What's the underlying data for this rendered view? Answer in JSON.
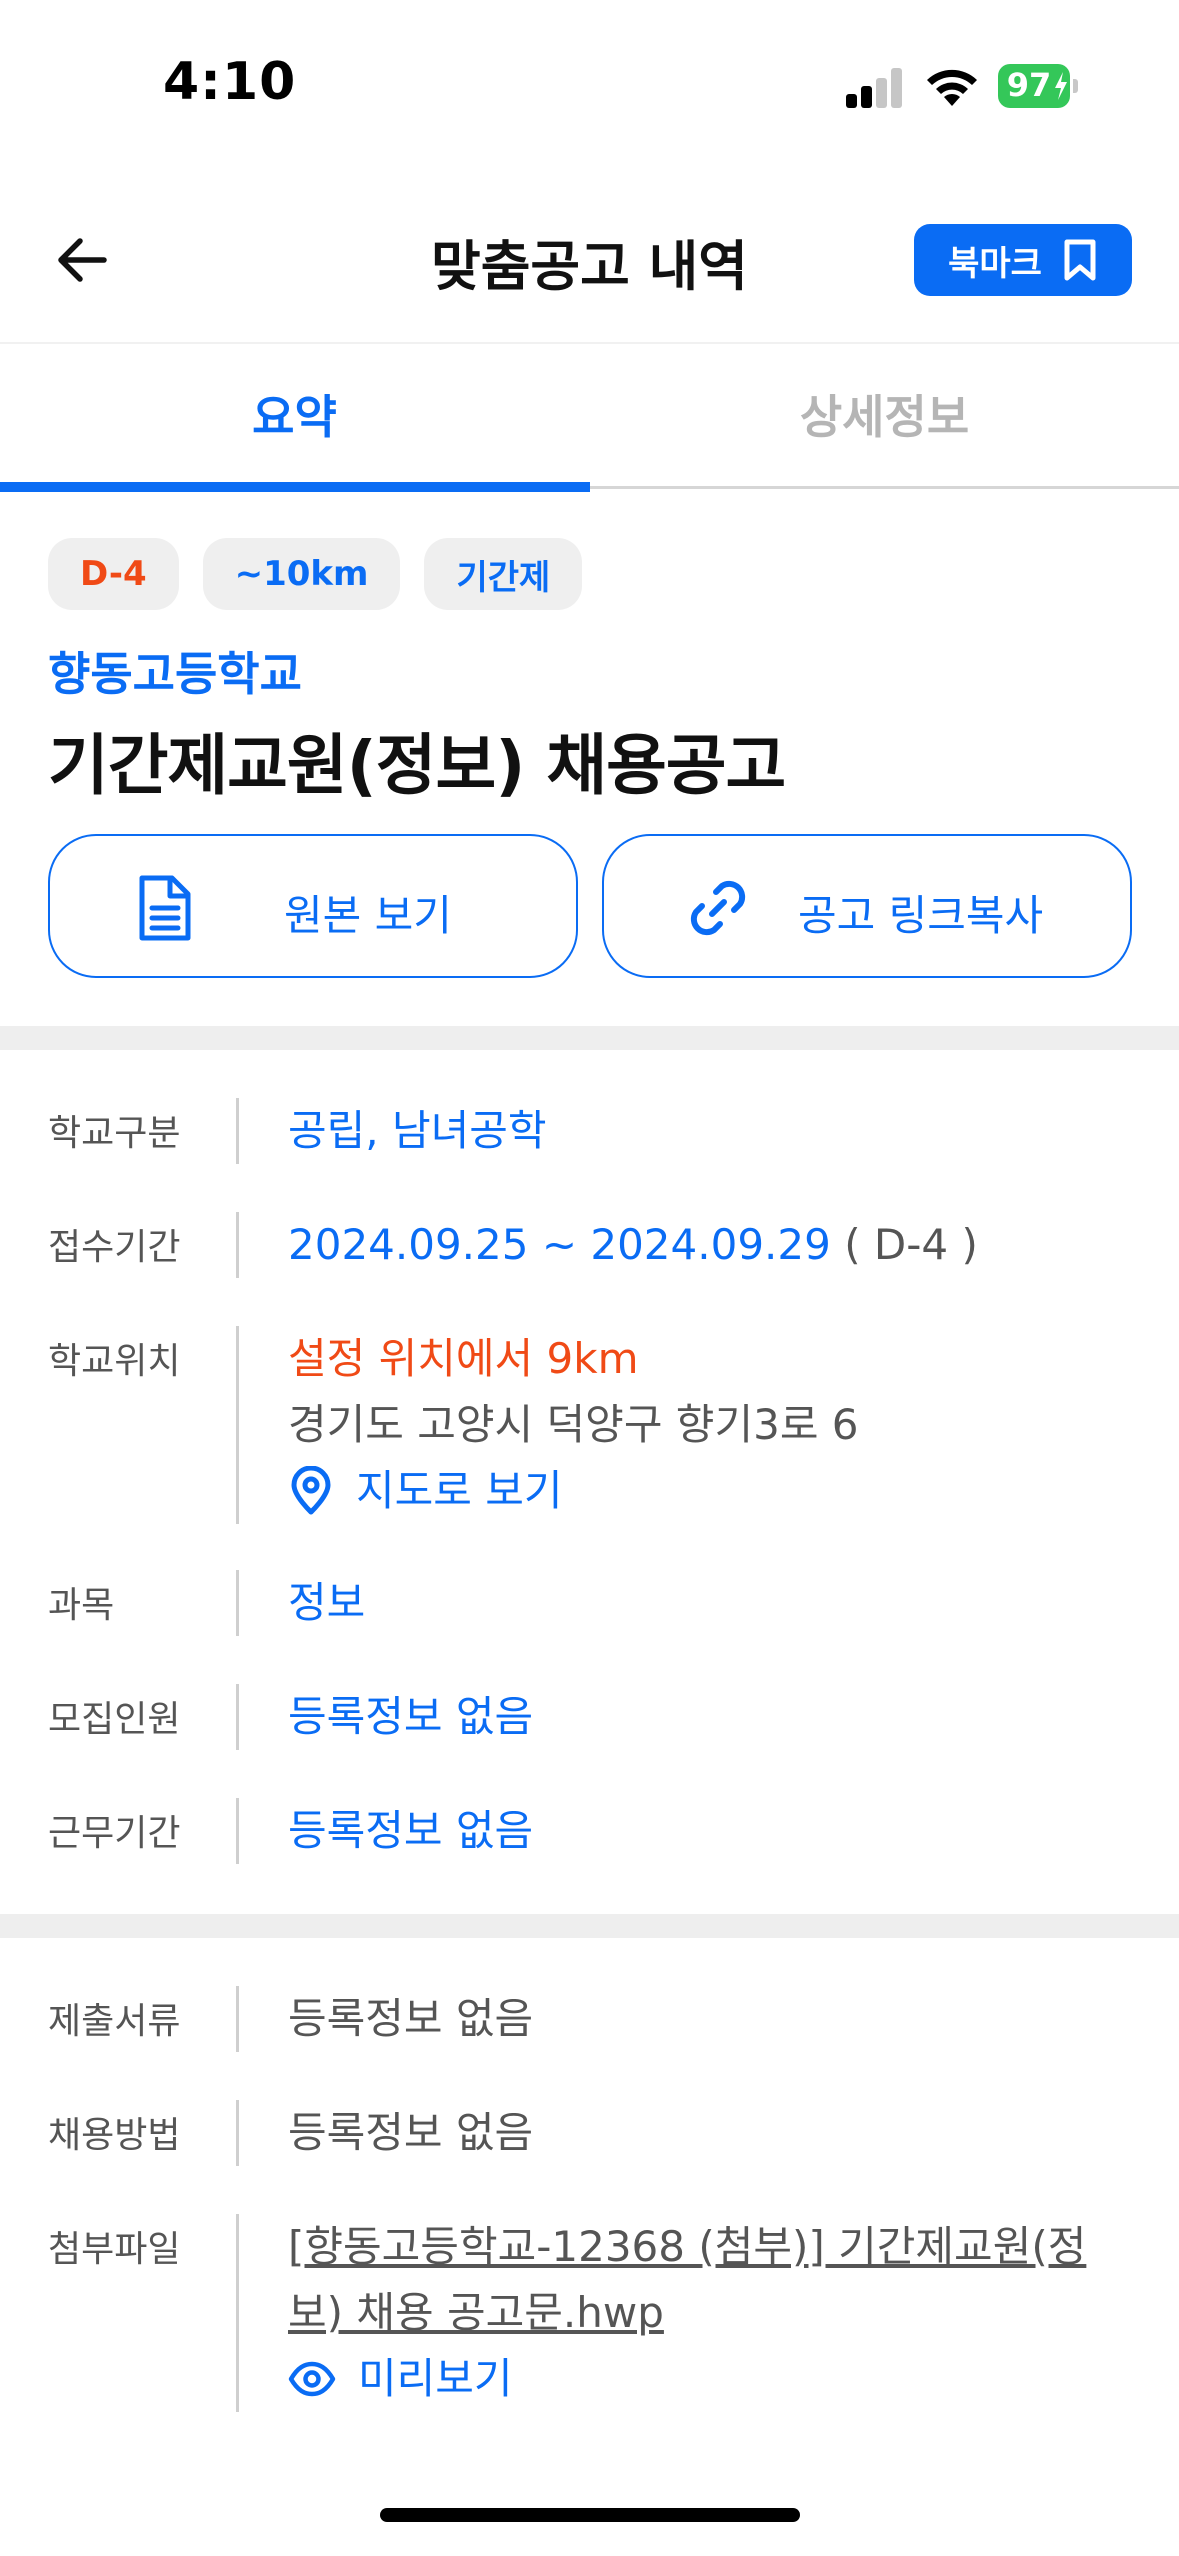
{
  "status_bar": {
    "time": "4:10",
    "battery_percent": "97",
    "battery_color": "#34c759",
    "icons": [
      "cellular-signal-icon",
      "wifi-icon",
      "battery-charging-icon"
    ]
  },
  "header": {
    "title": "맞춤공고 내역",
    "back_icon": "arrow-left-icon",
    "bookmark_label": "북마크",
    "bookmark_icon": "bookmark-icon"
  },
  "tabs": [
    {
      "label": "요약",
      "active": true
    },
    {
      "label": "상세정보",
      "active": false
    }
  ],
  "chips": {
    "dday": "D-4",
    "distance": "~10km",
    "type": "기간제"
  },
  "posting": {
    "school_name": "향동고등학교",
    "title": "기간제교원(정보) 채용공고"
  },
  "actions": {
    "original_label": "원본 보기",
    "original_icon": "document-icon",
    "copy_link_label": "공고 링크복사",
    "copy_link_icon": "link-icon"
  },
  "info": {
    "school_type": {
      "label": "학교구분",
      "value": "공립, 남녀공학"
    },
    "period": {
      "label": "접수기간",
      "value": "2024.09.25 ~ 2024.09.29",
      "dday": " ( D-4 )"
    },
    "location": {
      "label": "학교위치",
      "distance": "설정 위치에서 9km",
      "address": "경기도 고양시 덕양구 향기3로 6",
      "map_label": "지도로 보기",
      "map_icon": "location-pin-icon"
    },
    "subject": {
      "label": "과목",
      "value": "정보"
    },
    "recruits": {
      "label": "모집인원",
      "value": "등록정보 없음"
    },
    "work_period": {
      "label": "근무기간",
      "value": "등록정보 없음"
    }
  },
  "info2": {
    "documents": {
      "label": "제출서류",
      "value": "등록정보 없음"
    },
    "method": {
      "label": "채용방법",
      "value": "등록정보 없음"
    },
    "attachment": {
      "label": "첨부파일",
      "file_line1": "[향동고등학교-12368 (첨부)] 기간제교원(정",
      "file_line2": "보) 채용 공고문.hwp",
      "preview_label": "미리보기",
      "preview_icon": "eye-icon"
    }
  },
  "colors": {
    "accent": "#0a6cf4",
    "warning": "#f04a16"
  }
}
